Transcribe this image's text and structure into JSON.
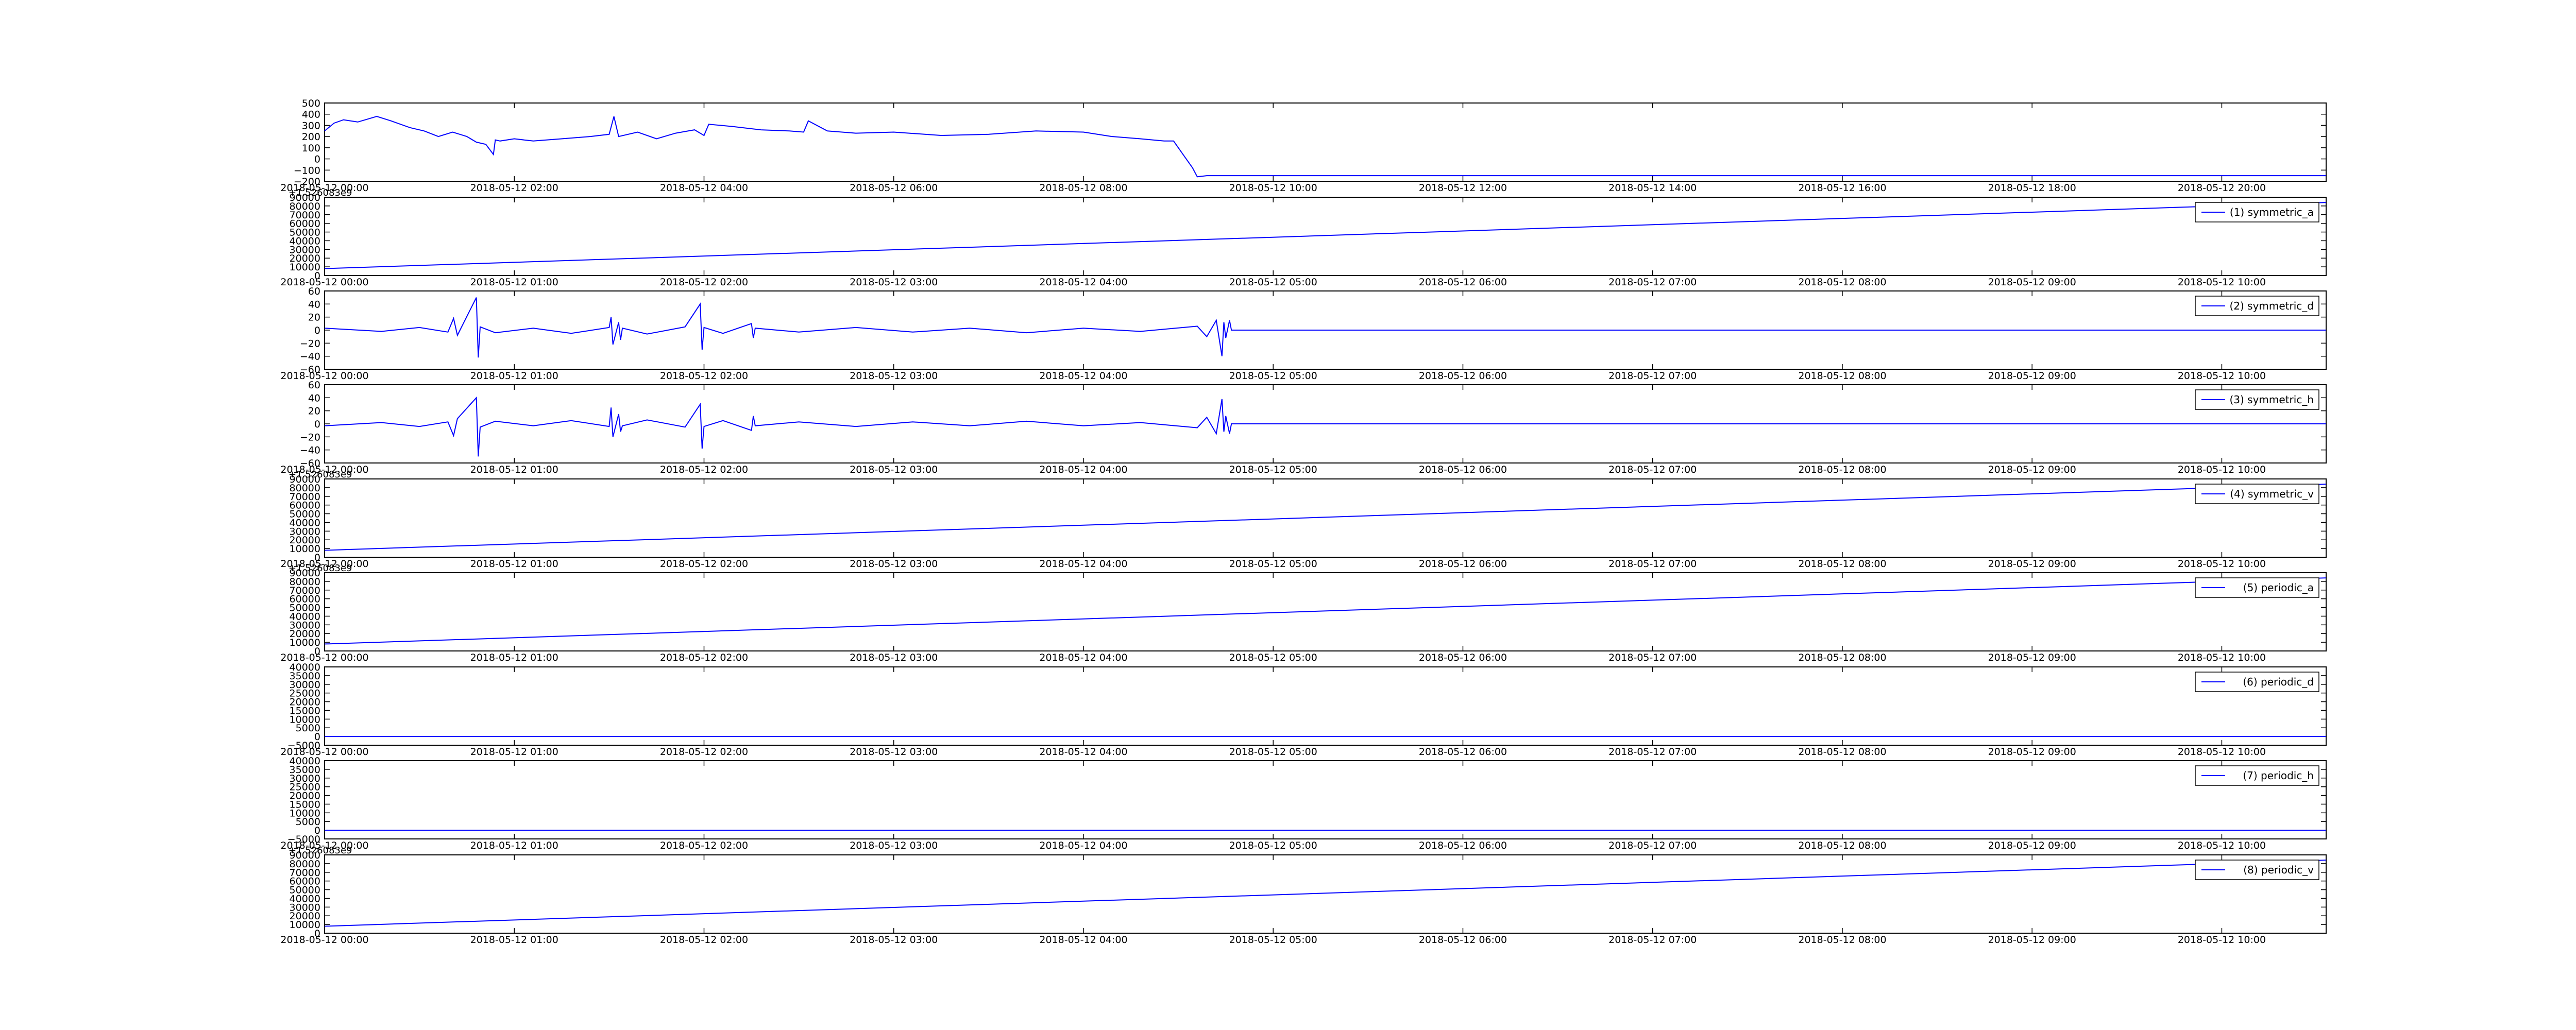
{
  "figure": {
    "background": "#ffffff",
    "line_color": "#0000ff",
    "axis_color": "#000000"
  },
  "chart_data": [
    {
      "type": "line",
      "ylim": [
        -200,
        500
      ],
      "yticks": [
        "500",
        "400",
        "300",
        "200",
        "100",
        "0",
        "−100",
        "−200"
      ],
      "xtick_labels": [
        "2018-05-12 00:00",
        "2018-05-12 02:00",
        "2018-05-12 04:00",
        "2018-05-12 06:00",
        "2018-05-12 08:00",
        "2018-05-12 10:00",
        "2018-05-12 12:00",
        "2018-05-12 14:00",
        "2018-05-12 16:00",
        "2018-05-12 18:00",
        "2018-05-12 20:00"
      ],
      "offset_text": "",
      "legend": "",
      "x_hours": [
        0,
        0.1,
        0.2,
        0.35,
        0.55,
        0.7,
        0.9,
        1.05,
        1.2,
        1.35,
        1.5,
        1.6,
        1.7,
        1.78,
        1.8,
        1.85,
        2.0,
        2.2,
        2.5,
        2.8,
        3.0,
        3.05,
        3.1,
        3.3,
        3.5,
        3.7,
        3.9,
        4.0,
        4.05,
        4.3,
        4.6,
        4.9,
        5.05,
        5.1,
        5.3,
        5.6,
        6.0,
        6.5,
        7.0,
        7.5,
        8.0,
        8.3,
        8.6,
        8.85,
        8.95,
        9.05,
        9.15,
        9.2,
        9.3,
        21.1
      ],
      "values": [
        250,
        320,
        350,
        330,
        380,
        340,
        280,
        250,
        200,
        240,
        200,
        150,
        130,
        40,
        170,
        160,
        180,
        160,
        180,
        200,
        220,
        380,
        200,
        240,
        180,
        230,
        260,
        210,
        310,
        290,
        260,
        250,
        240,
        340,
        250,
        230,
        240,
        210,
        220,
        250,
        240,
        200,
        180,
        160,
        160,
        40,
        -80,
        -160,
        -150,
        -150
      ]
    },
    {
      "type": "line",
      "ylim": [
        0,
        90000
      ],
      "yticks": [
        "90000",
        "80000",
        "70000",
        "60000",
        "50000",
        "40000",
        "30000",
        "20000",
        "10000",
        "0"
      ],
      "xtick_labels": [
        "2018-05-12 00:00",
        "2018-05-12 01:00",
        "2018-05-12 02:00",
        "2018-05-12 03:00",
        "2018-05-12 04:00",
        "2018-05-12 05:00",
        "2018-05-12 06:00",
        "2018-05-12 07:00",
        "2018-05-12 08:00",
        "2018-05-12 09:00",
        "2018-05-12 10:00"
      ],
      "offset_text": "+1.526083e9",
      "legend": "(1) symmetric_a",
      "x_hours": [
        0,
        10.55
      ],
      "values": [
        8000,
        84000
      ]
    },
    {
      "type": "line",
      "ylim": [
        -60,
        60
      ],
      "yticks": [
        "60",
        "40",
        "20",
        "0",
        "−20",
        "−40",
        "−60"
      ],
      "xtick_labels": [
        "2018-05-12 00:00",
        "2018-05-12 01:00",
        "2018-05-12 02:00",
        "2018-05-12 03:00",
        "2018-05-12 04:00",
        "2018-05-12 05:00",
        "2018-05-12 06:00",
        "2018-05-12 07:00",
        "2018-05-12 08:00",
        "2018-05-12 09:00",
        "2018-05-12 10:00"
      ],
      "offset_text": "",
      "legend": "(2) symmetric_d",
      "x_hours": [
        0,
        0.3,
        0.5,
        0.65,
        0.68,
        0.7,
        0.8,
        0.81,
        0.82,
        0.9,
        1.1,
        1.3,
        1.5,
        1.51,
        1.52,
        1.55,
        1.56,
        1.57,
        1.7,
        1.9,
        1.98,
        1.99,
        2.0,
        2.1,
        2.25,
        2.26,
        2.27,
        2.5,
        2.8,
        3.1,
        3.4,
        3.7,
        4.0,
        4.3,
        4.6,
        4.65,
        4.7,
        4.73,
        4.74,
        4.75,
        4.77,
        4.78,
        10.55
      ],
      "values": [
        3,
        -2,
        4,
        -3,
        18,
        -8,
        50,
        -42,
        5,
        -4,
        3,
        -5,
        4,
        20,
        -22,
        12,
        -15,
        3,
        -6,
        5,
        40,
        -30,
        4,
        -5,
        10,
        -12,
        3,
        -3,
        4,
        -3,
        3,
        -4,
        3,
        -2,
        6,
        -10,
        15,
        -40,
        12,
        -12,
        15,
        0,
        0
      ]
    },
    {
      "type": "line",
      "ylim": [
        -60,
        60
      ],
      "yticks": [
        "60",
        "40",
        "20",
        "0",
        "−20",
        "−40",
        "−60"
      ],
      "xtick_labels": [
        "2018-05-12 00:00",
        "2018-05-12 01:00",
        "2018-05-12 02:00",
        "2018-05-12 03:00",
        "2018-05-12 04:00",
        "2018-05-12 05:00",
        "2018-05-12 06:00",
        "2018-05-12 07:00",
        "2018-05-12 08:00",
        "2018-05-12 09:00",
        "2018-05-12 10:00"
      ],
      "offset_text": "",
      "legend": "(3) symmetric_h",
      "x_hours": [
        0,
        0.3,
        0.5,
        0.65,
        0.68,
        0.7,
        0.8,
        0.81,
        0.82,
        0.9,
        1.1,
        1.3,
        1.5,
        1.51,
        1.52,
        1.55,
        1.56,
        1.57,
        1.7,
        1.9,
        1.98,
        1.99,
        2.0,
        2.1,
        2.25,
        2.26,
        2.27,
        2.5,
        2.8,
        3.1,
        3.4,
        3.7,
        4.0,
        4.3,
        4.6,
        4.65,
        4.7,
        4.73,
        4.74,
        4.75,
        4.77,
        4.78,
        10.55
      ],
      "values": [
        -3,
        2,
        -4,
        3,
        -18,
        8,
        40,
        -50,
        -5,
        4,
        -3,
        5,
        -4,
        25,
        -20,
        15,
        -12,
        -3,
        6,
        -5,
        30,
        -38,
        -4,
        5,
        -10,
        12,
        -3,
        3,
        -4,
        3,
        -3,
        4,
        -3,
        2,
        -6,
        10,
        -15,
        38,
        -12,
        12,
        -15,
        0,
        0
      ]
    },
    {
      "type": "line",
      "ylim": [
        0,
        90000
      ],
      "yticks": [
        "90000",
        "80000",
        "70000",
        "60000",
        "50000",
        "40000",
        "30000",
        "20000",
        "10000",
        "0"
      ],
      "xtick_labels": [
        "2018-05-12 00:00",
        "2018-05-12 01:00",
        "2018-05-12 02:00",
        "2018-05-12 03:00",
        "2018-05-12 04:00",
        "2018-05-12 05:00",
        "2018-05-12 06:00",
        "2018-05-12 07:00",
        "2018-05-12 08:00",
        "2018-05-12 09:00",
        "2018-05-12 10:00"
      ],
      "offset_text": "+1.526083e9",
      "legend": "(4) symmetric_v",
      "x_hours": [
        0,
        10.55
      ],
      "values": [
        8000,
        84000
      ]
    },
    {
      "type": "line",
      "ylim": [
        0,
        90000
      ],
      "yticks": [
        "90000",
        "80000",
        "70000",
        "60000",
        "50000",
        "40000",
        "30000",
        "20000",
        "10000",
        "0"
      ],
      "xtick_labels": [
        "2018-05-12 00:00",
        "2018-05-12 01:00",
        "2018-05-12 02:00",
        "2018-05-12 03:00",
        "2018-05-12 04:00",
        "2018-05-12 05:00",
        "2018-05-12 06:00",
        "2018-05-12 07:00",
        "2018-05-12 08:00",
        "2018-05-12 09:00",
        "2018-05-12 10:00"
      ],
      "offset_text": "+1.526083e9",
      "legend": "(5) periodic_a",
      "x_hours": [
        0,
        10.55
      ],
      "values": [
        8000,
        84000
      ]
    },
    {
      "type": "line",
      "ylim": [
        -5000,
        40000
      ],
      "yticks": [
        "40000",
        "35000",
        "30000",
        "25000",
        "20000",
        "15000",
        "10000",
        "5000",
        "0",
        "−5000"
      ],
      "xtick_labels": [
        "2018-05-12 00:00",
        "2018-05-12 01:00",
        "2018-05-12 02:00",
        "2018-05-12 03:00",
        "2018-05-12 04:00",
        "2018-05-12 05:00",
        "2018-05-12 06:00",
        "2018-05-12 07:00",
        "2018-05-12 08:00",
        "2018-05-12 09:00",
        "2018-05-12 10:00"
      ],
      "offset_text": "",
      "legend": "(6) periodic_d",
      "x_hours": [
        0,
        10.55
      ],
      "values": [
        0,
        0
      ]
    },
    {
      "type": "line",
      "ylim": [
        -5000,
        40000
      ],
      "yticks": [
        "40000",
        "35000",
        "30000",
        "25000",
        "20000",
        "15000",
        "10000",
        "5000",
        "0",
        "−5000"
      ],
      "xtick_labels": [
        "2018-05-12 00:00",
        "2018-05-12 01:00",
        "2018-05-12 02:00",
        "2018-05-12 03:00",
        "2018-05-12 04:00",
        "2018-05-12 05:00",
        "2018-05-12 06:00",
        "2018-05-12 07:00",
        "2018-05-12 08:00",
        "2018-05-12 09:00",
        "2018-05-12 10:00"
      ],
      "offset_text": "",
      "legend": "(7) periodic_h",
      "x_hours": [
        0,
        10.55
      ],
      "values": [
        0,
        0
      ]
    },
    {
      "type": "line",
      "ylim": [
        0,
        90000
      ],
      "yticks": [
        "90000",
        "80000",
        "70000",
        "60000",
        "50000",
        "40000",
        "30000",
        "20000",
        "10000",
        "0"
      ],
      "xtick_labels": [
        "2018-05-12 00:00",
        "2018-05-12 01:00",
        "2018-05-12 02:00",
        "2018-05-12 03:00",
        "2018-05-12 04:00",
        "2018-05-12 05:00",
        "2018-05-12 06:00",
        "2018-05-12 07:00",
        "2018-05-12 08:00",
        "2018-05-12 09:00",
        "2018-05-12 10:00"
      ],
      "offset_text": "+1.526083e9",
      "legend": "(8) periodic_v",
      "x_hours": [
        0,
        10.55
      ],
      "values": [
        8000,
        84000
      ]
    }
  ]
}
